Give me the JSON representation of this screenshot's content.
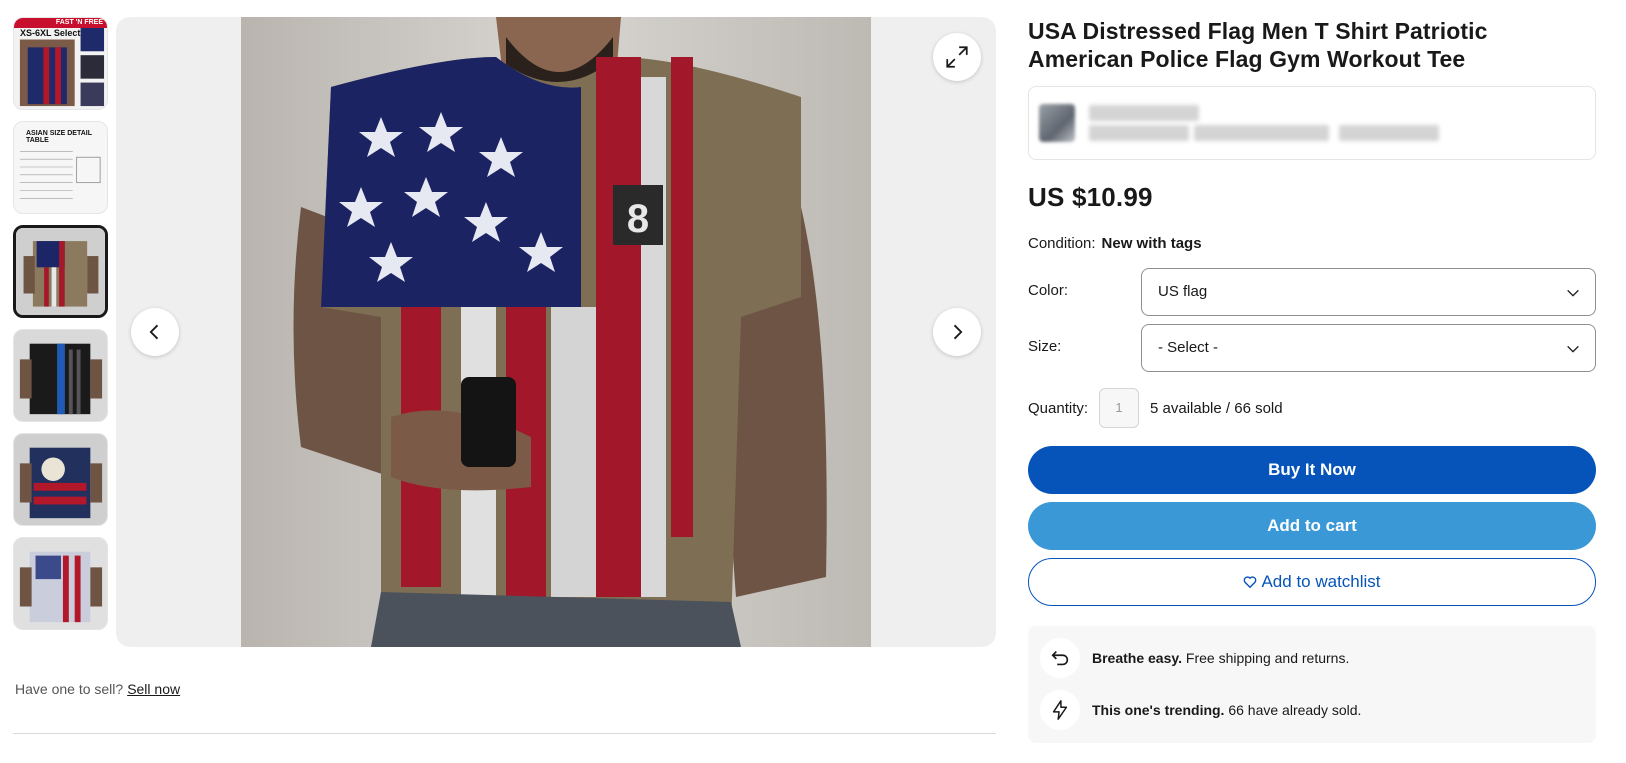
{
  "thumbnails": [
    {
      "label": "XS-6XL Select",
      "banner": "FAST 'N FREE"
    },
    {
      "label": "ASIAN SIZE DETAIL TABLE"
    },
    {
      "label": ""
    },
    {
      "label": ""
    },
    {
      "label": ""
    },
    {
      "label": ""
    }
  ],
  "sell": {
    "prompt": "Have one to sell?",
    "link": "Sell now"
  },
  "product": {
    "title": "USA Distressed Flag Men T Shirt Patriotic American Police Flag Gym Workout Tee",
    "price": "US $10.99",
    "condition_label": "Condition:",
    "condition_value": "New with tags"
  },
  "options": {
    "color_label": "Color:",
    "color_value": "US flag",
    "size_label": "Size:",
    "size_value": "- Select -"
  },
  "quantity": {
    "label": "Quantity:",
    "value": "1",
    "availability": "5 available / 66 sold"
  },
  "actions": {
    "buy_now": "Buy It Now",
    "add_to_cart": "Add to cart",
    "add_to_watchlist": "Add to watchlist"
  },
  "promos": [
    {
      "bold": "Breathe easy.",
      "text": " Free shipping and returns.",
      "icon": "return-arrow-icon"
    },
    {
      "bold": "This one's trending.",
      "text": " 66 have already sold.",
      "icon": "lightning-icon"
    }
  ],
  "colors": {
    "primary_blue": "#0654ba",
    "cart_blue": "#3a98d6",
    "text": "#191919"
  }
}
